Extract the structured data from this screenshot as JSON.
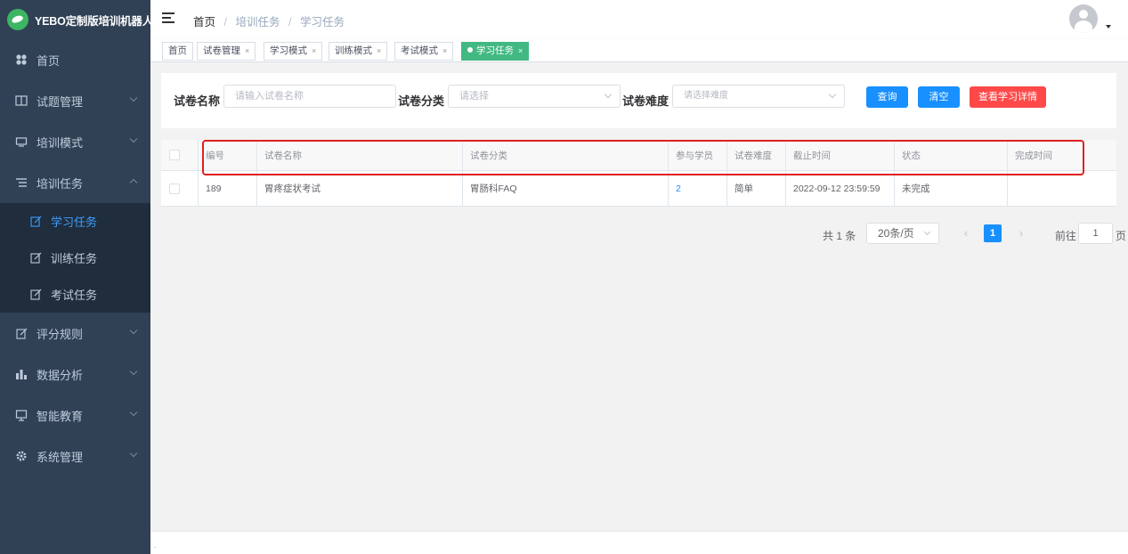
{
  "app": {
    "title": "YEBO定制版培训机器人"
  },
  "sidebar": {
    "items": [
      {
        "label": "首页",
        "icon": "dashboard-icon"
      },
      {
        "label": "试题管理",
        "icon": "book-icon"
      },
      {
        "label": "培训模式",
        "icon": "monitor-icon"
      },
      {
        "label": "培训任务",
        "icon": "list-icon",
        "expanded": true
      },
      {
        "label": "评分规则",
        "icon": "edit-icon"
      },
      {
        "label": "数据分析",
        "icon": "chart-icon"
      },
      {
        "label": "智能教育",
        "icon": "screen-icon"
      },
      {
        "label": "系统管理",
        "icon": "gear-icon"
      }
    ],
    "submenu": [
      {
        "label": "学习任务",
        "active": true
      },
      {
        "label": "训练任务"
      },
      {
        "label": "考试任务"
      }
    ]
  },
  "breadcrumb": {
    "home": "首页",
    "parent": "培训任务",
    "current": "学习任务",
    "separator": "/"
  },
  "tags": [
    {
      "label": "首页",
      "close": ""
    },
    {
      "label": "试卷管理",
      "close": "×"
    },
    {
      "label": "学习模式",
      "close": "×"
    },
    {
      "label": "训练模式",
      "close": "×"
    },
    {
      "label": "考试模式",
      "close": "×"
    },
    {
      "label": "学习任务",
      "close": "×",
      "active": true
    }
  ],
  "search": {
    "name_label": "试卷名称",
    "name_placeholder": "请输入试卷名称",
    "category_label": "试卷分类",
    "category_placeholder": "请选择",
    "difficulty_label": "试卷难度",
    "difficulty_placeholder": "请选择难度",
    "query_button": "查询",
    "clear_button": "清空",
    "detail_button": "查看学习详情"
  },
  "table": {
    "columns": [
      "编号",
      "试卷名称",
      "试卷分类",
      "参与学员",
      "试卷难度",
      "截止时间",
      "状态",
      "完成时间"
    ],
    "rows": [
      {
        "id": "189",
        "name": "胃疼症状考试",
        "category": "胃肠科FAQ",
        "participants": "2",
        "difficulty": "简单",
        "deadline": "2022-09-12 23:59:59",
        "status": "未完成",
        "finished": ""
      }
    ]
  },
  "pagination": {
    "total_text": "共 1 条",
    "page_size": "20条/页",
    "prev": "‹",
    "current_page": "1",
    "next": "›",
    "goto_label": "前往",
    "goto_value": "1",
    "page_unit": "页"
  },
  "footer": {
    "dot": "."
  },
  "colors": {
    "sidebar_bg": "#304156",
    "submenu_bg": "#1f2d3d",
    "active_link": "#409eff",
    "primary": "#1890ff",
    "danger": "#ff4949",
    "tag_active": "#42b983",
    "highlight_border": "#e02020"
  }
}
